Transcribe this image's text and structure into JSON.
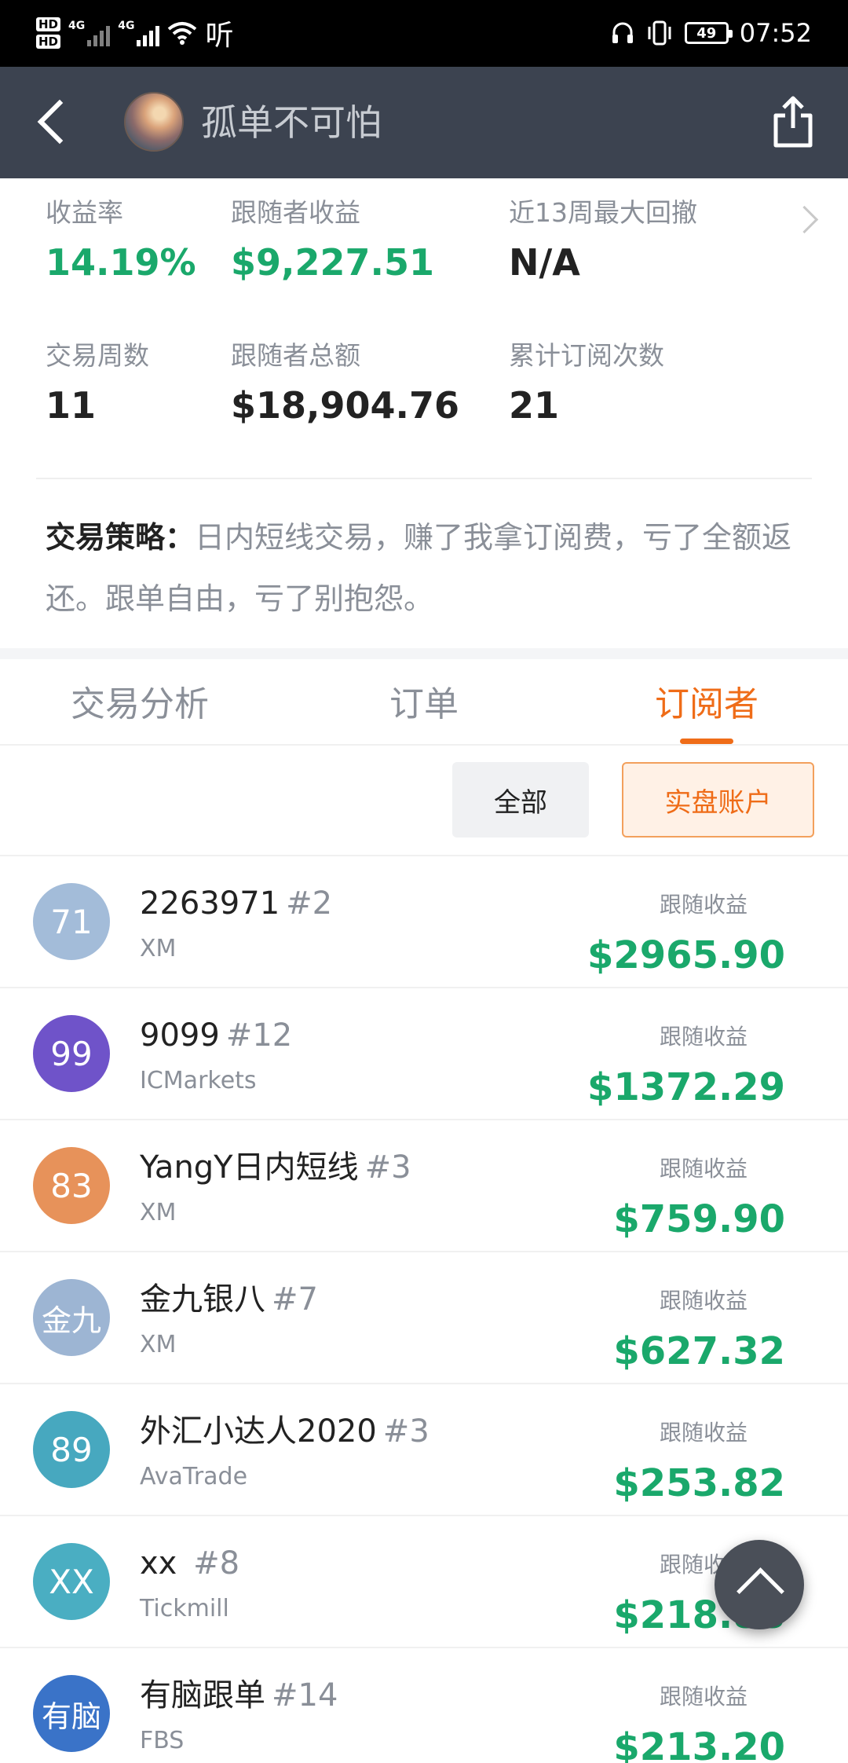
{
  "status_bar": {
    "hd1": "HD",
    "hd2": "HD",
    "net1": "4G",
    "net2": "4G",
    "listen": "听",
    "battery": "49",
    "time": "07:52"
  },
  "header": {
    "title": "孤单不可怕",
    "back_icon": "back-arrow-icon",
    "share_icon": "share-icon"
  },
  "stats": {
    "return_rate": {
      "label": "收益率",
      "value": "14.19%"
    },
    "follower_profit": {
      "label": "跟随者收益",
      "value": "$9,227.51"
    },
    "max_drawdown": {
      "label": "近13周最大回撤",
      "value": "N/A"
    },
    "trade_weeks": {
      "label": "交易周数",
      "value": "11"
    },
    "follower_total": {
      "label": "跟随者总额",
      "value": "$18,904.76"
    },
    "subscriptions": {
      "label": "累计订阅次数",
      "value": "21"
    }
  },
  "strategy": {
    "label": "交易策略：",
    "text": "日内短线交易，赚了我拿订阅费，亏了全额返还。跟单自由，亏了别抱怨。"
  },
  "tabs": [
    "交易分析",
    "订单",
    "订阅者"
  ],
  "active_tab": 2,
  "filters": {
    "all": "全部",
    "real": "实盘账户"
  },
  "colors": {
    "accent": "#ef6c18",
    "positive": "#1aa86b",
    "header_bg": "#3c4350"
  },
  "subscribers": [
    {
      "avatar": "71",
      "color": "#a3bcd9",
      "name": "2263971",
      "rank": "#2",
      "broker": "XM",
      "earn_label": "跟随收益",
      "earn": "$2965.90"
    },
    {
      "avatar": "99",
      "color": "#6f53c9",
      "name": "9099",
      "rank": "#12",
      "broker": "ICMarkets",
      "earn_label": "跟随收益",
      "earn": "$1372.29"
    },
    {
      "avatar": "83",
      "color": "#e7925a",
      "name": "YangY日内短线",
      "rank": "#3",
      "broker": "XM",
      "earn_label": "跟随收益",
      "earn": "$759.90"
    },
    {
      "avatar": "金九",
      "color": "#9db5d3",
      "name": "金九银八",
      "rank": "#7",
      "broker": "XM",
      "earn_label": "跟随收益",
      "earn": "$627.32"
    },
    {
      "avatar": "89",
      "color": "#47a8bf",
      "name": "外汇小达人2020",
      "rank": "#3",
      "broker": "AvaTrade",
      "earn_label": "跟随收益",
      "earn": "$253.82"
    },
    {
      "avatar": "XX",
      "color": "#4aaec2",
      "name": "xx ",
      "rank": "#8",
      "broker": "Tickmill",
      "earn_label": "跟随收益",
      "earn": "$218.88"
    },
    {
      "avatar": "有脑",
      "color": "#3a73c8",
      "name": "有脑跟单",
      "rank": "#14",
      "broker": "FBS",
      "earn_label": "跟随收益",
      "earn": "$213.20"
    }
  ]
}
